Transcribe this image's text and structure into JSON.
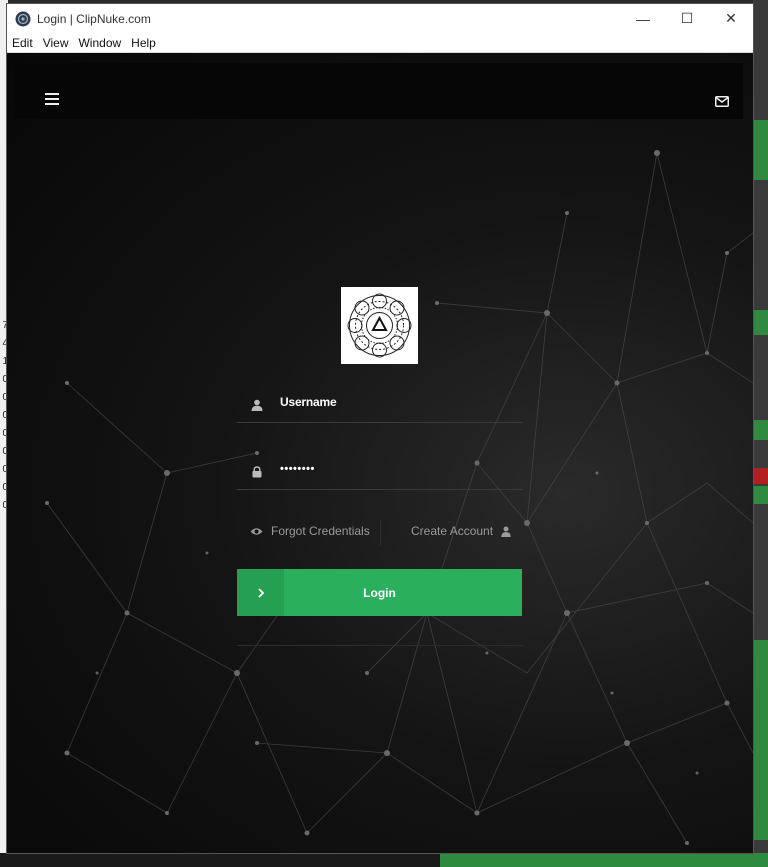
{
  "window": {
    "title": "Login | ClipNuke.com",
    "controls": {
      "minimize": "—",
      "maximize": "☐",
      "close": "✕"
    }
  },
  "menu": [
    "Edit",
    "View",
    "Window",
    "Help"
  ],
  "background_numbers": [
    "7",
    "4",
    "1",
    "0",
    "0",
    "0",
    "0",
    "0",
    "0",
    "0",
    "0"
  ],
  "header": {
    "menu_icon": "hamburger-icon",
    "mail_icon": "envelope-icon"
  },
  "form": {
    "username_value": "Username",
    "password_value": "••••••••",
    "forgot_label": "Forgot Credentials",
    "create_label": "Create Account",
    "login_label": "Login"
  },
  "colors": {
    "accent": "#2ab05d",
    "accent_dark": "#25a052",
    "background": "#0b0b0b"
  }
}
